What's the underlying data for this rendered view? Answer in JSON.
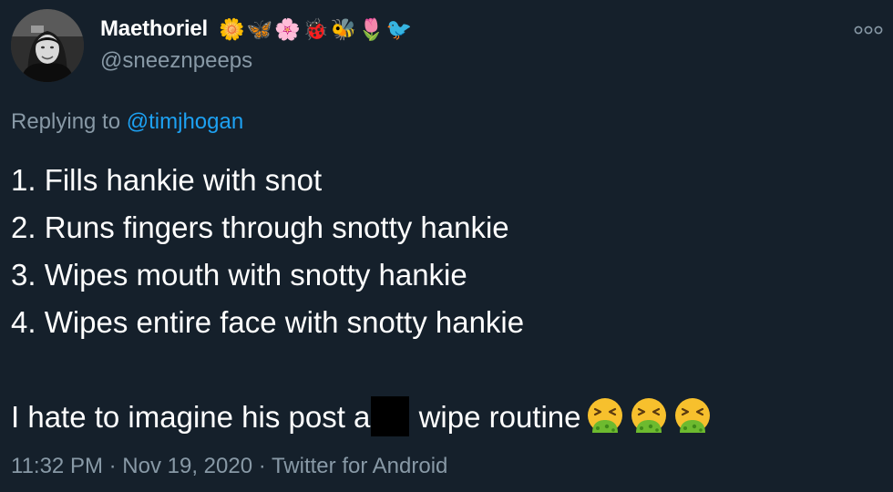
{
  "author": {
    "display_name": "Maethoriel",
    "name_emojis": "🌼🦋🌸🐞🐝🌷🐦",
    "handle": "@sneeznpeeps"
  },
  "reply": {
    "prefix": "Replying to ",
    "mention": "@timjhogan"
  },
  "body": {
    "lines": [
      "1. Fills hankie with snot",
      "2. Runs fingers through snotty hankie",
      "3. Wipes mouth with snotty hankie",
      "4. Wipes entire face with snotty hankie"
    ],
    "closing_before": "I hate to imagine his post a",
    "closing_after": " wipe routine",
    "closing_emoji_count": 3,
    "closing_emoji_name": "vomiting-face-icon"
  },
  "meta": {
    "time": "11:32 PM",
    "separator": " · ",
    "date": "Nov 19, 2020",
    "source": "Twitter for Android"
  },
  "colors": {
    "background": "#15202b",
    "text": "#ffffff",
    "muted": "#8899a6",
    "link": "#1da1f2"
  }
}
